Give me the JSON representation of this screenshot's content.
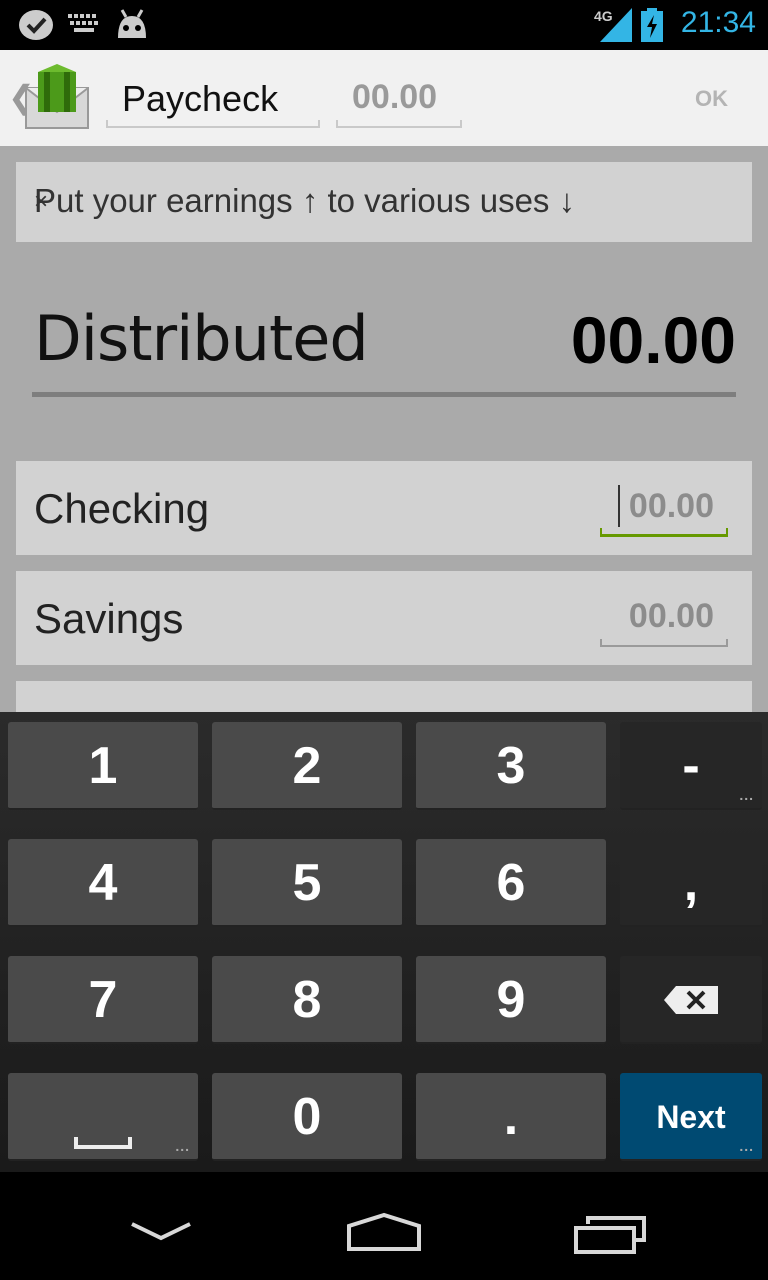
{
  "status_bar": {
    "time": "21:34",
    "network": "4G",
    "icons": [
      "notification-check-icon",
      "keyboard-icon",
      "android-icon",
      "signal-icon",
      "battery-charging-icon"
    ]
  },
  "action_bar": {
    "title_value": "Paycheck",
    "amount_placeholder": "00.00",
    "ok_label": "OK",
    "app_icon": "envelope-money-icon"
  },
  "hint": {
    "text": "Put your earnings ↑ to various uses ↓",
    "close": "×"
  },
  "distributed": {
    "label": "Distributed",
    "value": "00.00"
  },
  "accounts": [
    {
      "name": "Checking",
      "placeholder": "00.00"
    },
    {
      "name": "Savings",
      "placeholder": "00.00"
    }
  ],
  "keyboard": {
    "row1": [
      "1",
      "2",
      "3",
      "-"
    ],
    "row2": [
      "4",
      "5",
      "6",
      ","
    ],
    "row3": [
      "7",
      "8",
      "9"
    ],
    "row4": [
      "0",
      "."
    ],
    "next_label": "Next",
    "more_dots": "..."
  },
  "colors": {
    "accent_status": "#33b5e5",
    "focus_underline": "#669900",
    "next_key": "#004a72"
  }
}
